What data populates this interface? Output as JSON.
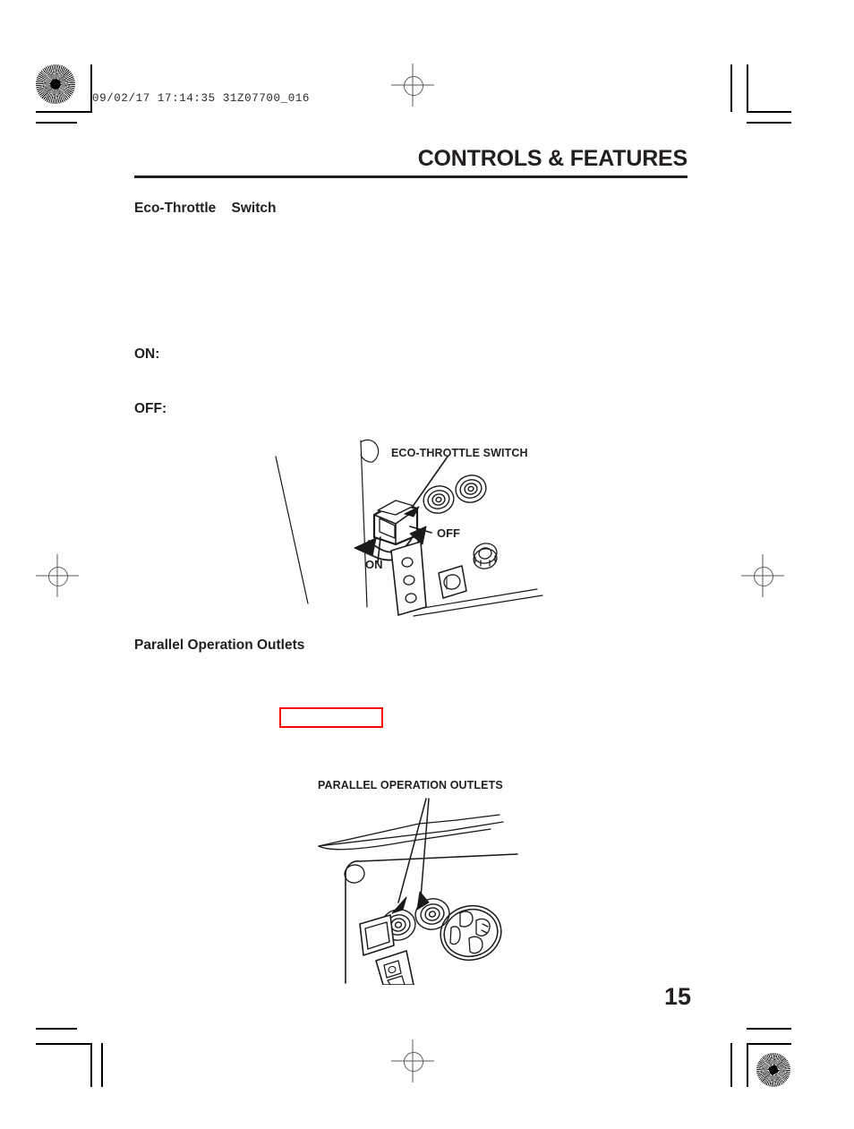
{
  "document": {
    "scan_slug": "09/02/17 17:14:35 31Z07700_016",
    "header_title": "CONTROLS & FEATURES",
    "page_number": "15"
  },
  "sections": [
    {
      "heading": "Eco-Throttle    Switch",
      "states": [
        {
          "label": "ON:",
          "text": ""
        },
        {
          "label": "OFF:",
          "text": ""
        }
      ]
    },
    {
      "heading": "Parallel Operation Outlets"
    }
  ],
  "figures": [
    {
      "id": "eco-throttle-switch-figure",
      "callouts": [
        {
          "name": "switch-callout",
          "text": "ECO-THROTTLE SWITCH"
        },
        {
          "name": "off-callout",
          "text": "OFF"
        },
        {
          "name": "on-callout",
          "text": "ON"
        }
      ]
    },
    {
      "id": "parallel-operation-outlets-figure",
      "callouts": [
        {
          "name": "outlets-callout",
          "text": "PARALLEL OPERATION OUTLETS"
        }
      ]
    }
  ],
  "annotations": {
    "redbox_color": "#ff0000"
  }
}
